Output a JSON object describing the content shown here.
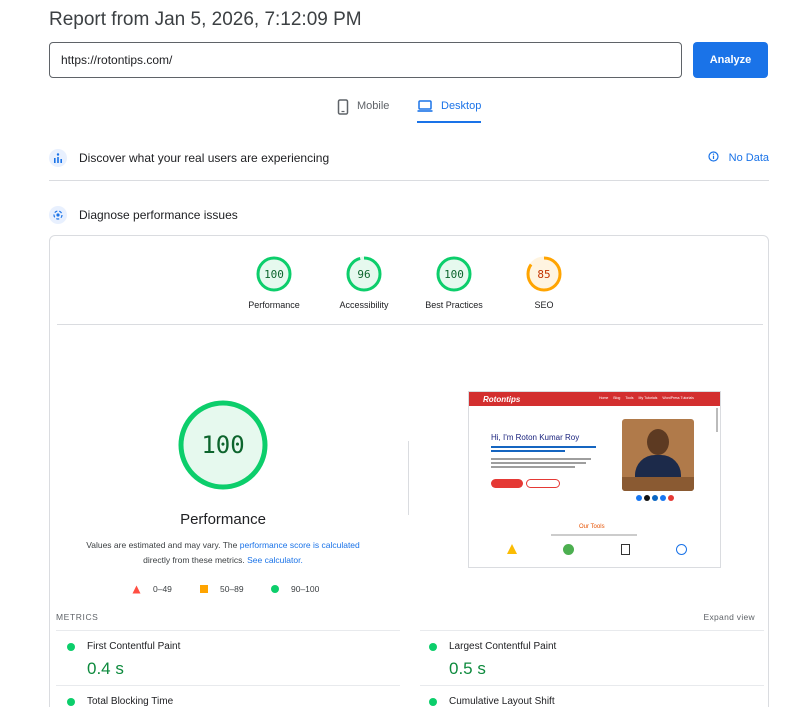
{
  "report": {
    "title": "Report from Jan 5, 2026, 7:12:09 PM"
  },
  "url_form": {
    "value": "https://rotontips.com/",
    "analyze_label": "Analyze"
  },
  "tabs": [
    {
      "label": "Mobile",
      "icon": "phone-icon",
      "active": false
    },
    {
      "label": "Desktop",
      "icon": "laptop-icon",
      "active": true
    }
  ],
  "discover": {
    "text": "Discover what your real users are experiencing",
    "no_data": "No Data"
  },
  "diagnose": {
    "text": "Diagnose performance issues"
  },
  "scores": [
    {
      "label": "Performance",
      "value": "100",
      "color": "#0cce6b"
    },
    {
      "label": "Accessibility",
      "value": "96",
      "color": "#0cce6b"
    },
    {
      "label": "Best Practices",
      "value": "100",
      "color": "#0cce6b"
    },
    {
      "label": "SEO",
      "value": "85",
      "color": "#ffa400"
    }
  ],
  "main_score": {
    "value": "100",
    "label": "Performance",
    "note_1": "Values are estimated and may vary. The ",
    "note_link_1": "performance score is calculated",
    "note_2": "directly from these metrics. ",
    "note_link_2": "See calculator."
  },
  "legend": [
    {
      "range": "0–49",
      "color": "#ff4e42",
      "shape": "triangle"
    },
    {
      "range": "50–89",
      "color": "#ffa400",
      "shape": "square"
    },
    {
      "range": "90–100",
      "color": "#0cce6b",
      "shape": "circle"
    }
  ],
  "screenshot": {
    "logo": "Rotontips",
    "nav": [
      "Home",
      "Blog",
      "Tools",
      "My Tutorials",
      "WordPress Tutorials"
    ],
    "heading": "Hi, I'm Roton Kumar Roy",
    "section_title": "Our Tools"
  },
  "metrics": {
    "heading": "METRICS",
    "expand": "Expand view",
    "items": [
      {
        "name": "First Contentful Paint",
        "value": "0.4 s"
      },
      {
        "name": "Largest Contentful Paint",
        "value": "0.5 s"
      },
      {
        "name": "Total Blocking Time",
        "value": ""
      },
      {
        "name": "Cumulative Layout Shift",
        "value": ""
      }
    ]
  },
  "colors": {
    "accent": "#1a73e8",
    "pass": "#0cce6b",
    "average": "#ffa400",
    "fail": "#ff4e42"
  }
}
